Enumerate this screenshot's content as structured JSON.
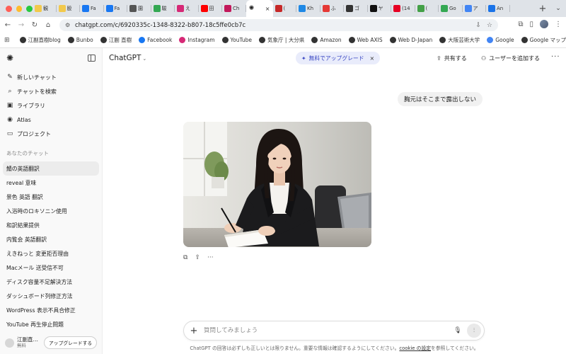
{
  "browser": {
    "traffic_colors": [
      "#ff5f57",
      "#febc2e",
      "#28c840"
    ],
    "tabs": [
      {
        "label": "観",
        "icon": "folder-icon",
        "color": "#f2c94c"
      },
      {
        "label": "股",
        "icon": "folder-icon",
        "color": "#f2c94c"
      },
      {
        "label": "Fa",
        "icon": "facebook-icon",
        "color": "#1877f2"
      },
      {
        "label": "Fa",
        "icon": "facebook-icon",
        "color": "#1877f2"
      },
      {
        "label": "園",
        "icon": "globe-icon",
        "color": "#555555"
      },
      {
        "label": "駿",
        "icon": "app-icon",
        "color": "#34a853"
      },
      {
        "label": "え",
        "icon": "instagram-icon",
        "color": "#d62976"
      },
      {
        "label": "田",
        "icon": "youtube-icon",
        "color": "#ff0000"
      },
      {
        "label": "Ch",
        "icon": "app-icon",
        "color": "#c2185b"
      },
      {
        "label": "",
        "icon": "chatgpt-icon",
        "color": "#222222",
        "active": true
      },
      {
        "label": "(",
        "icon": "app-icon",
        "color": "#c62828"
      },
      {
        "label": "Kh",
        "icon": "app-icon",
        "color": "#1e88e5"
      },
      {
        "label": "ふ",
        "icon": "app-icon",
        "color": "#e53935"
      },
      {
        "label": "ゴ",
        "icon": "note-icon",
        "color": "#333333"
      },
      {
        "label": "ヤ",
        "icon": "note-icon",
        "color": "#111111"
      },
      {
        "label": "(14",
        "icon": "pinterest-icon",
        "color": "#e60023"
      },
      {
        "label": "(",
        "icon": "app-icon",
        "color": "#43a047"
      },
      {
        "label": "Go",
        "icon": "maps-icon",
        "color": "#34a853"
      },
      {
        "label": "ア",
        "icon": "google-icon",
        "color": "#4285f4"
      },
      {
        "label": "An",
        "icon": "app-icon",
        "color": "#1a73e8"
      }
    ],
    "new_tab_label": "+",
    "url": "chatgpt.com/c/6920335c-1348-8322-b807-18c5ffe0cb7c"
  },
  "bookmarks": [
    {
      "label": "江副直樹blog",
      "icon": "globe-icon",
      "color": "#333333"
    },
    {
      "label": "Bunbo",
      "icon": "globe-icon",
      "color": "#333333"
    },
    {
      "label": "江副 直樹",
      "icon": "globe-icon",
      "color": "#333333"
    },
    {
      "label": "Facebook",
      "icon": "facebook-icon",
      "color": "#1877f2"
    },
    {
      "label": "Instagram",
      "icon": "instagram-icon",
      "color": "#d62976"
    },
    {
      "label": "YouTube",
      "icon": "globe-icon",
      "color": "#333333"
    },
    {
      "label": "気象庁 | 大分県",
      "icon": "globe-icon",
      "color": "#333333"
    },
    {
      "label": "Amazon",
      "icon": "globe-icon",
      "color": "#333333"
    },
    {
      "label": "Web AXIS",
      "icon": "globe-icon",
      "color": "#333333"
    },
    {
      "label": "Web D-Japan",
      "icon": "globe-icon",
      "color": "#333333"
    },
    {
      "label": "大阪芸術大学",
      "icon": "globe-icon",
      "color": "#333333"
    },
    {
      "label": "Google",
      "icon": "google-icon",
      "color": "#4285f4"
    },
    {
      "label": "Google マップ",
      "icon": "globe-icon",
      "color": "#333333"
    }
  ],
  "sidebar": {
    "nav": [
      {
        "label": "新しいチャット",
        "icon": "new-chat-icon"
      },
      {
        "label": "チャットを検索",
        "icon": "search-icon"
      },
      {
        "label": "ライブラリ",
        "icon": "library-icon"
      },
      {
        "label": "Atlas",
        "icon": "atlas-icon"
      },
      {
        "label": "プロジェクト",
        "icon": "folder-icon"
      }
    ],
    "section_title": "あなたのチャット",
    "chats": [
      {
        "label": "鯖の英語翻訳",
        "active": true
      },
      {
        "label": "reveal 意味"
      },
      {
        "label": "景色 英語 翻訳"
      },
      {
        "label": "入浴時のロキソニン使用"
      },
      {
        "label": "和訳結果提供"
      },
      {
        "label": "内覧会 英語翻訳"
      },
      {
        "label": "えきねっと 変更拒否理由"
      },
      {
        "label": "Macメール 送受信不可"
      },
      {
        "label": "ディスク容量不足解決方法"
      },
      {
        "label": "ダッシュボード列修正方法"
      },
      {
        "label": "WordPress 表示不具合修正"
      },
      {
        "label": "YouTube 再生停止問題"
      }
    ],
    "user": {
      "name": "江副直…",
      "plan": "無料",
      "upgrade_label": "アップグレードする"
    }
  },
  "header": {
    "model": "ChatGPT",
    "promo_label": "無料でアップグレード",
    "share_label": "共有する",
    "add_user_label": "ユーザーを追加する"
  },
  "conversation": {
    "user_message": "胸元はそこまで露出しない"
  },
  "composer": {
    "placeholder": "質問してみましょう",
    "disclaimer_prefix": "ChatGPT の回答は必ずしも正しいとは限りません。重要な情報は確認するようにしてください。",
    "disclaimer_link": "cookie の設定",
    "disclaimer_suffix": "を参照してください。"
  }
}
